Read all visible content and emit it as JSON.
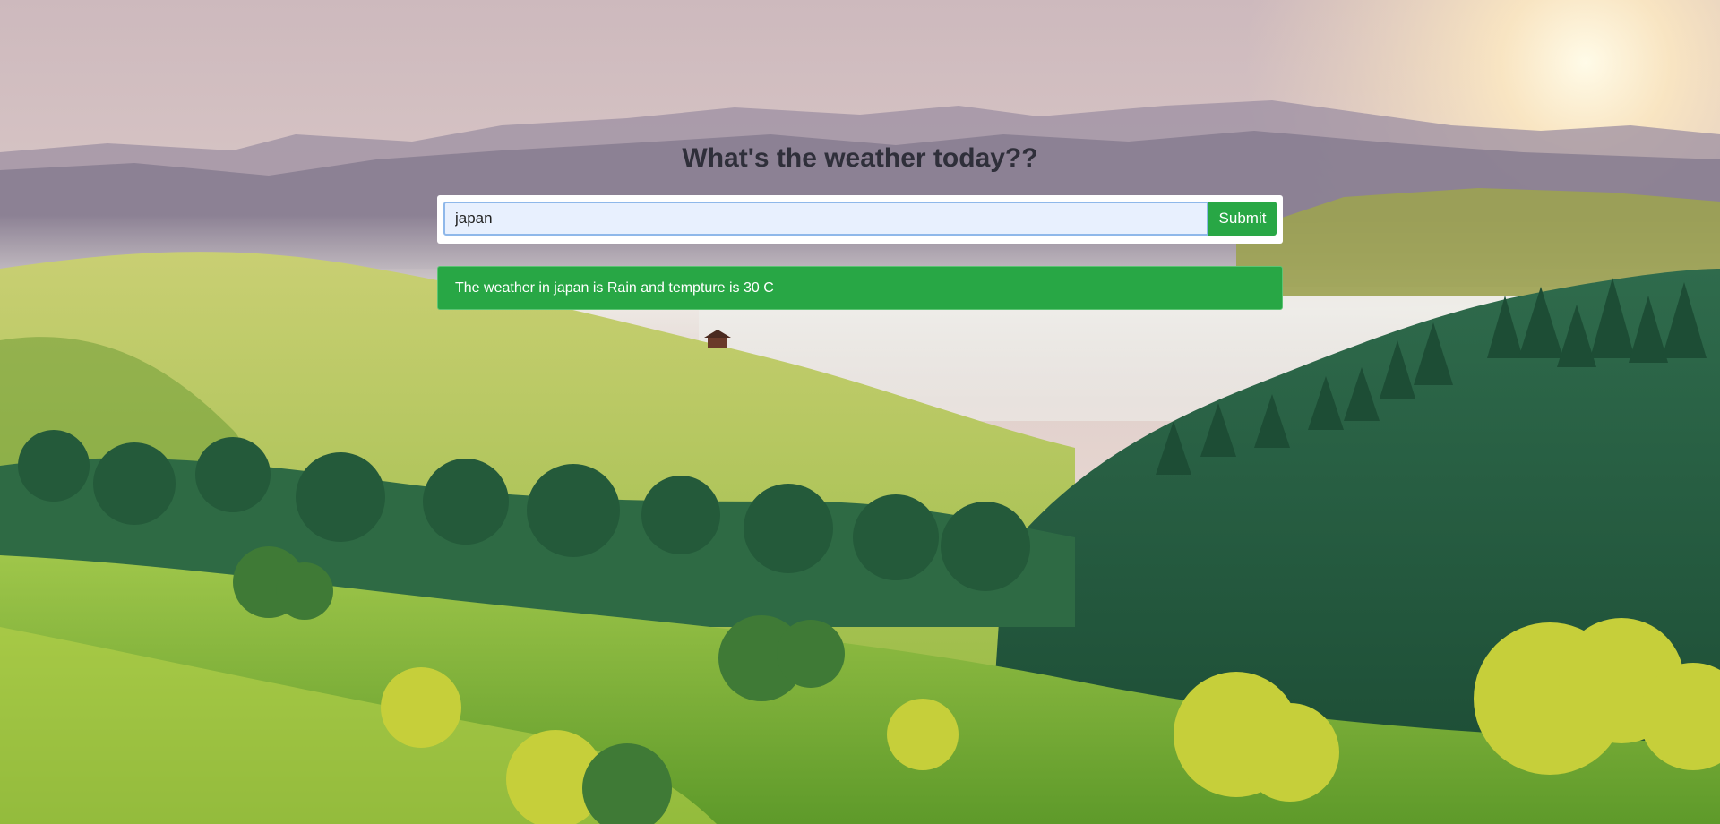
{
  "page": {
    "heading": "What's the weather today??"
  },
  "search": {
    "value": "japan",
    "placeholder": "",
    "submit_label": "Submit"
  },
  "result": {
    "message": "The weather in japan is Rain and tempture is 30 C"
  },
  "background": {
    "subject": "misty green hills and pine forest at sunrise",
    "colors": {
      "sky_top": "#d9c7c7",
      "sky_glow": "#fff1cf",
      "mountains": "#8a7f93",
      "grass_light": "#a9c84a",
      "grass_dark": "#5f9a2e",
      "forest": "#1f5238"
    }
  },
  "colors": {
    "accent_green": "#28a745",
    "input_bg": "#e8f0fe",
    "input_border": "#8fb8ea",
    "heading_text": "#2f2f3a"
  }
}
